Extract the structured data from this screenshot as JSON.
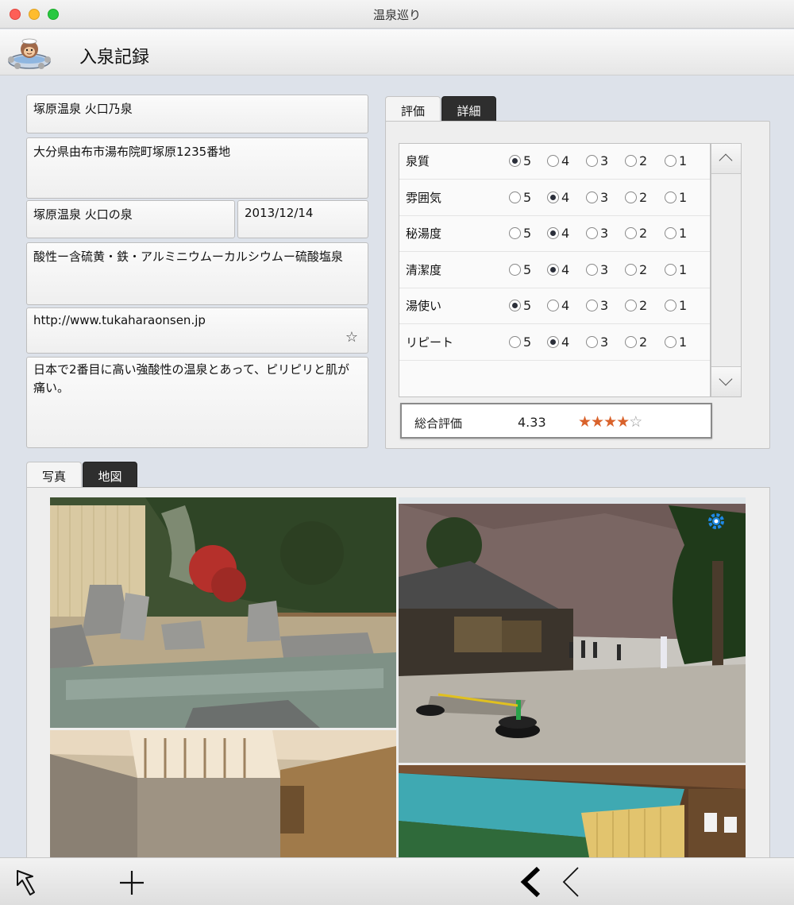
{
  "window": {
    "title": "温泉巡り"
  },
  "header": {
    "title": "入泉記録"
  },
  "form": {
    "name": "塚原温泉 火口乃泉",
    "address": "大分県由布市湯布院町塚原1235番地",
    "facility": "塚原温泉 火口の泉",
    "date": "2013/12/14",
    "spring_type": "酸性ー含硫黄・鉄・アルミニウムーカルシウムー硫酸塩泉",
    "url": "http://www.tukaharaonsen.jp",
    "memo": "日本で2番目に高い強酸性の温泉とあって、ピリピリと肌が痛い。"
  },
  "rating_tabs": [
    {
      "label": "評価",
      "active": true
    },
    {
      "label": "詳細",
      "active": false
    }
  ],
  "ratings": [
    {
      "label": "泉質",
      "selected": 5
    },
    {
      "label": "雰囲気",
      "selected": 4
    },
    {
      "label": "秘湯度",
      "selected": 4
    },
    {
      "label": "清潔度",
      "selected": 4
    },
    {
      "label": "湯使い",
      "selected": 5
    },
    {
      "label": "リピート",
      "selected": 4
    }
  ],
  "rating_options": [
    "5",
    "4",
    "3",
    "2",
    "1"
  ],
  "summary": {
    "label": "総合評価",
    "value": "4.33",
    "stars_filled": 4,
    "stars_total": 5
  },
  "media_tabs": [
    {
      "label": "写真",
      "active": true
    },
    {
      "label": "地図",
      "active": false
    }
  ],
  "icons": {
    "logo": "monkey-onsen-icon",
    "url_action": "star-icon",
    "photo_settings": "gear-icon",
    "toolbar": [
      "return-arrow-icon",
      "plus-icon",
      "back-bold-icon",
      "back-thin-icon"
    ]
  },
  "colors": {
    "star": "#d9622b",
    "gear": "#1e88e5",
    "tab_dark": "#2e2e2e"
  }
}
